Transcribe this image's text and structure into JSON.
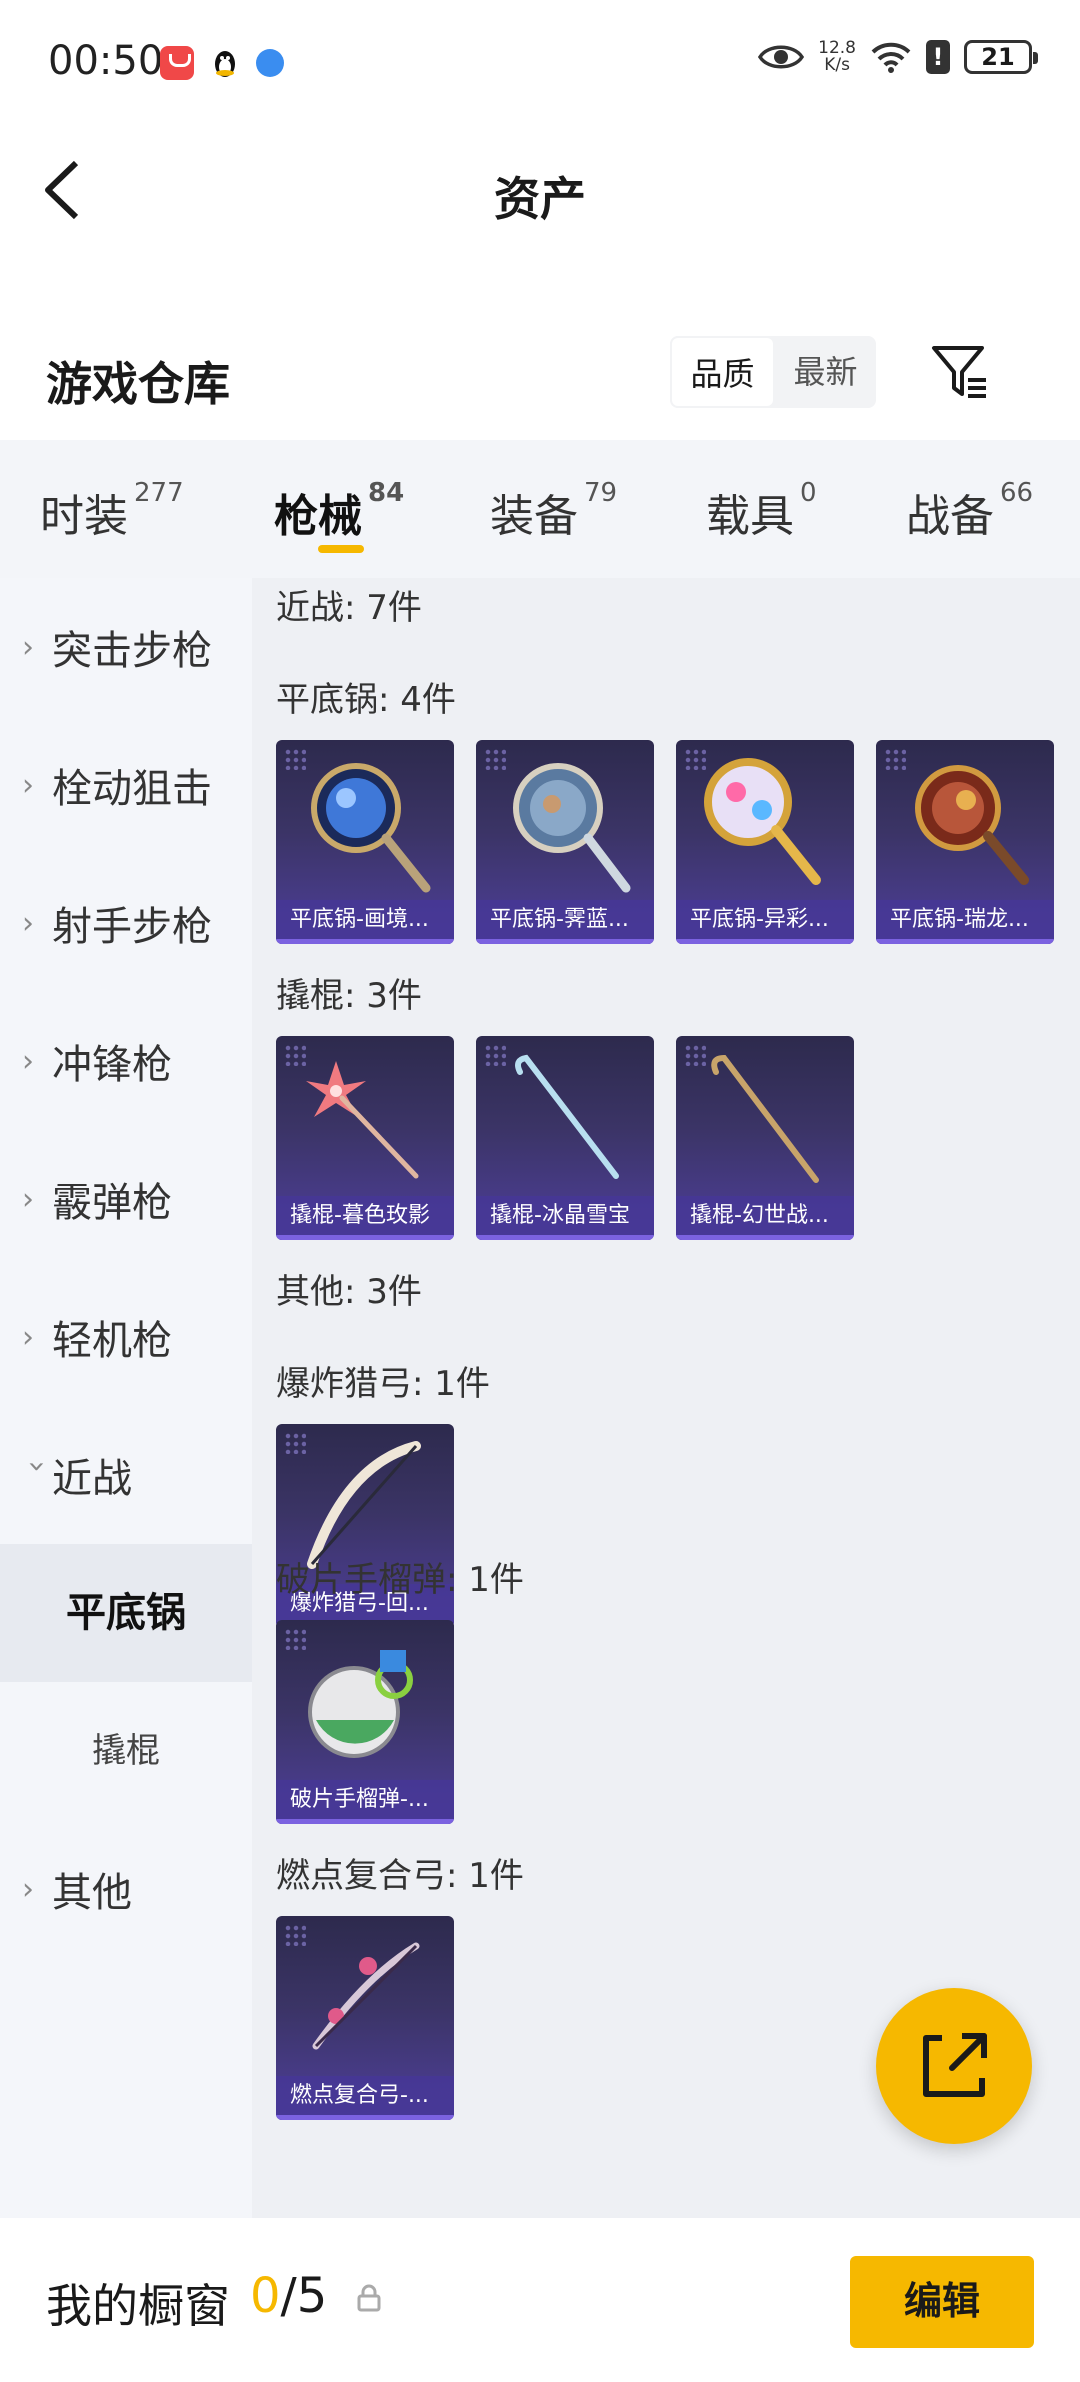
{
  "status_bar": {
    "time": "00:50",
    "speed_value": "12.8",
    "speed_unit": "K/s",
    "alert": "!",
    "battery": "21"
  },
  "header": {
    "title": "资产"
  },
  "warehouse": {
    "title": "游戏仓库",
    "sort_options": [
      "品质",
      "最新"
    ],
    "active_sort": "品质"
  },
  "tabs": [
    {
      "label": "时装",
      "count": "277"
    },
    {
      "label": "枪械",
      "count": "84"
    },
    {
      "label": "装备",
      "count": "79"
    },
    {
      "label": "载具",
      "count": "0"
    },
    {
      "label": "战备",
      "count": "66"
    }
  ],
  "active_tab": "枪械",
  "sidebar": {
    "items": [
      {
        "label": "突击步枪"
      },
      {
        "label": "栓动狙击"
      },
      {
        "label": "射手步枪"
      },
      {
        "label": "冲锋枪"
      },
      {
        "label": "霰弹枪"
      },
      {
        "label": "轻机枪"
      },
      {
        "label": "近战"
      },
      {
        "label": "平底锅"
      },
      {
        "label": "撬棍"
      },
      {
        "label": "其他"
      }
    ]
  },
  "content": {
    "melee_header": "近战: 7件",
    "pan_header": "平底锅: 4件",
    "pan_items": [
      "平底锅-画境...",
      "平底锅-霁蓝...",
      "平底锅-异彩...",
      "平底锅-瑞龙..."
    ],
    "crowbar_header": "撬棍: 3件",
    "crowbar_items": [
      "撬棍-暮色玫影",
      "撬棍-冰晶雪宝",
      "撬棍-幻世战..."
    ],
    "other_header": "其他: 3件",
    "bow_header": "爆炸猎弓: 1件",
    "bow_items": [
      "爆炸猎弓-回..."
    ],
    "grenade_header": "破片手榴弹: 1件",
    "grenade_items": [
      "破片手榴弹-..."
    ],
    "compound_header": "燃点复合弓: 1件",
    "compound_items": [
      "燃点复合弓-..."
    ]
  },
  "bottom_bar": {
    "label": "我的橱窗",
    "count_used": "0",
    "count_sep": "/",
    "count_total": "5",
    "edit_label": "编辑"
  },
  "colors": {
    "accent": "#f6b800",
    "card_bg": "#3b3466",
    "sidebar_bg": "#f4f6fa",
    "content_bg": "#eef0f4"
  },
  "icons": [
    "back-arrow-icon",
    "filter-icon",
    "share-icon",
    "lock-icon",
    "chevron-right-icon",
    "chevron-down-icon",
    "eye-icon",
    "wifi-icon",
    "battery-icon"
  ]
}
